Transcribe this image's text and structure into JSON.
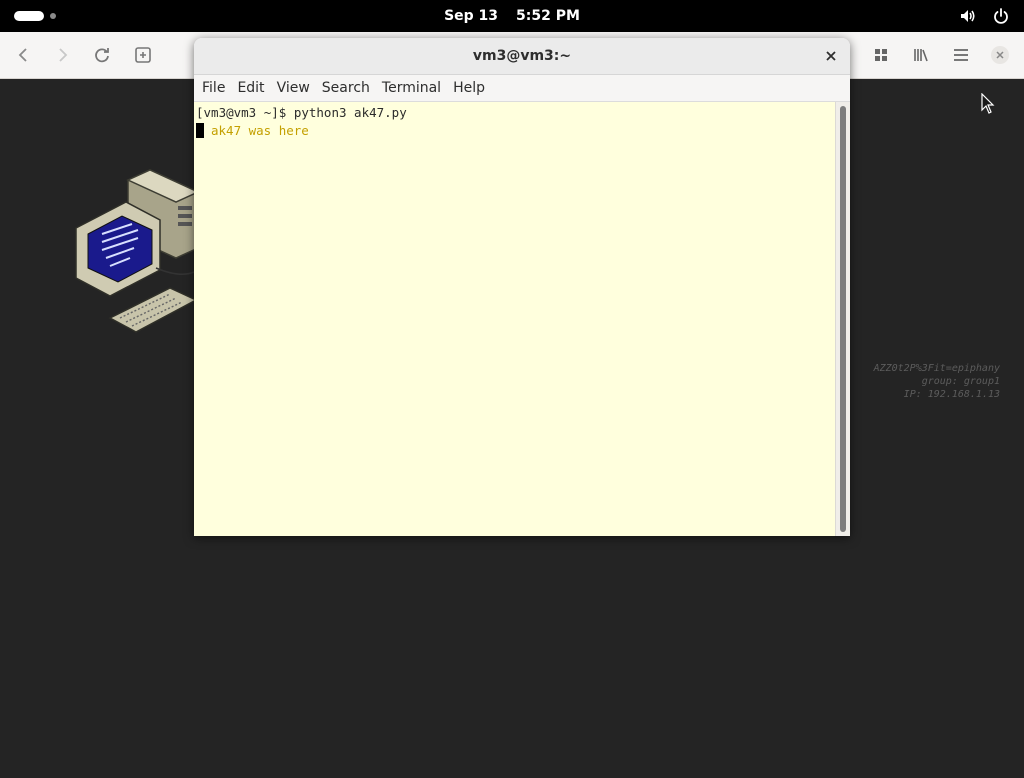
{
  "topbar": {
    "date": "Sep 13",
    "time": "5:52 PM",
    "activities_icon": "activities-pill-icon",
    "tray_icons": [
      "volume-icon",
      "power-icon"
    ]
  },
  "browser": {
    "icons": [
      "back-arrow-icon",
      "forward-arrow-icon",
      "reload-icon",
      "new-tab-icon",
      "grid-icon",
      "library-icon",
      "hamburger-menu-icon",
      "close-icon"
    ]
  },
  "desktop": {
    "watermark_lines": [
      "AZZ0t2P%3Fit=epiphany",
      "group: group1",
      "IP: 192.168.1.13"
    ]
  },
  "terminal": {
    "title": "vm3@vm3:~",
    "menu": [
      "File",
      "Edit",
      "View",
      "Search",
      "Terminal",
      "Help"
    ],
    "lines": {
      "command": "[vm3@vm3 ~]$ python3 ak47.py",
      "output": "ak47 was here"
    },
    "output_color": "#c4a000",
    "background_color": "#ffffdd"
  }
}
